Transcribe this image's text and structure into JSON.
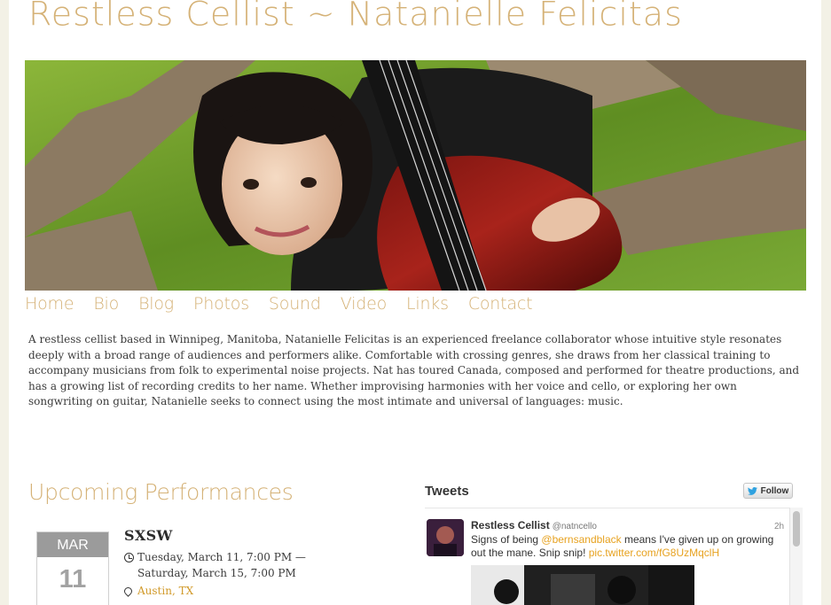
{
  "site": {
    "title": "Restless Cellist ~ Natanielle Felicitas"
  },
  "nav": {
    "items": [
      "Home",
      "Bio",
      "Blog",
      "Photos",
      "Sound",
      "Video",
      "Links",
      "Contact"
    ]
  },
  "bio": {
    "text": "A restless cellist based in Winnipeg, Manitoba, Natanielle Felicitas is an experienced freelance collaborator whose intuitive style resonates deeply with a broad range of audiences and performers alike. Comfortable with crossing genres, she draws from her classical training to accompany musicians from folk to experimental noise projects. Nat has toured Canada, composed and performed for theatre productions, and has a growing list of recording credits to her name. Whether improvising harmonies with her voice and cello, or exploring her own songwriting on guitar, Natanielle seeks to connect using the most intimate and universal of languages: music."
  },
  "performances": {
    "heading": "Upcoming Performances",
    "event": {
      "month": "MAR",
      "day": "11",
      "title": "SXSW",
      "time_line1": "Tuesday, March 11, 7:00 PM —",
      "time_line2": "Saturday, March 15, 7:00 PM",
      "location": "Austin, TX"
    }
  },
  "twitter": {
    "heading": "Tweets",
    "follow_label": "Follow",
    "tweet": {
      "name": "Restless Cellist",
      "handle": "@natncello",
      "time": "2h",
      "text_before": "Signs of being ",
      "mention": "@bernsandblack",
      "text_after": " means I've given up on growing out the mane. Snip snip! ",
      "link": "pic.twitter.com/fG8UzMqclH"
    }
  },
  "colors": {
    "accent": "#d5b277",
    "link": "#e7a220",
    "location": "#d19a2a"
  },
  "icons": {
    "clock": "clock-icon",
    "pin": "map-pin-icon",
    "twitter": "twitter-bird-icon"
  }
}
